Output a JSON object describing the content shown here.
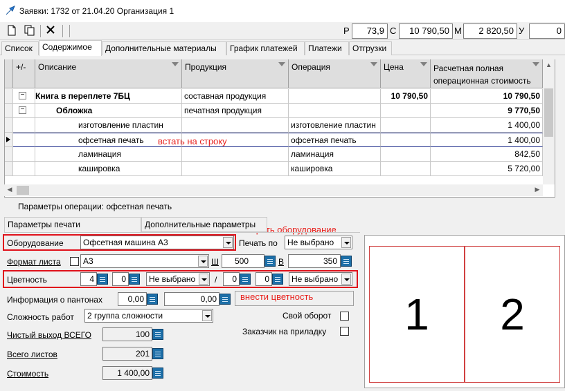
{
  "window": {
    "title": "Заявки: 1732 от 21.04.20  Организация 1"
  },
  "toolbar": {
    "icons": [
      "new-doc-icon",
      "copy-icon",
      "delete-icon"
    ],
    "summary": [
      {
        "label": "Р",
        "value": "73,9"
      },
      {
        "label": "С",
        "value": "10 790,50"
      },
      {
        "label": "М",
        "value": "2 820,50"
      },
      {
        "label": "У",
        "value": "0"
      }
    ]
  },
  "tabs": [
    "Список",
    "Содержимое",
    "Дополнительные материалы",
    "График платежей",
    "Платежи",
    "Отгрузки"
  ],
  "grid": {
    "headers": [
      "+/-",
      "Описание",
      "Продукция",
      "Операция",
      "Цена",
      "Расчетная полная операционная стоимость"
    ],
    "rows": [
      {
        "toggle": "−",
        "desc": "Книга в переплете 7БЦ",
        "product": "составная продукция",
        "operation": "",
        "price": "10 790,50",
        "cost": "10 790,50",
        "bold": true
      },
      {
        "toggle": "−",
        "desc": "Обложка",
        "product": "печатная продукция",
        "operation": "",
        "price": "",
        "cost": "9 770,50",
        "bold": true
      },
      {
        "toggle": "",
        "desc": "изготовление пластин",
        "product": "",
        "operation": "изготовление пластин",
        "price": "",
        "cost": "1 400,00"
      },
      {
        "toggle": "",
        "desc": "офсетная печать",
        "product": "",
        "operation": "офсетная печать",
        "price": "",
        "cost": "1 400,00",
        "current": true
      },
      {
        "toggle": "",
        "desc": "ламинация",
        "product": "",
        "operation": "ламинация",
        "price": "",
        "cost": "842,50"
      },
      {
        "toggle": "",
        "desc": "кашировка",
        "product": "",
        "operation": "кашировка",
        "price": "",
        "cost": "5 720,00"
      }
    ]
  },
  "annotations": {
    "select_row": "встать на строку",
    "select_equipment": "выбрать оборудование",
    "enter_color": "внести цветность"
  },
  "params": {
    "title": "Параметры операции: офсетная печать",
    "subtabs": [
      "Параметры печати",
      "Дополнительные параметры"
    ],
    "equipment_label": "Оборудование",
    "equipment_value": "Офсетная машина А3",
    "print_on_label": "Печать по",
    "print_on_value": "Не выбрано",
    "format_label": "Формат листа",
    "format_value": "А3",
    "width_label": "Ш",
    "width_value": "500",
    "height_label": "В",
    "height_value": "350",
    "color_label": "Цветность",
    "color_front_1": "4",
    "color_front_2": "0",
    "color_front_select": "Не выбрано",
    "color_slash": "/",
    "color_back_1": "0",
    "color_back_2": "0",
    "color_back_select": "Не выбрано",
    "pantone_label": "Информация о пантонах",
    "pantone_1": "0,00",
    "pantone_2": "0,00",
    "complexity_label": "Сложность работ",
    "complexity_value": "2 группа сложности",
    "own_turnover_label": "Свой оборот",
    "customer_label": "Заказчик на приладку",
    "net_output_label": "Чистый выход ВСЕГО",
    "net_output_value": "100",
    "sheets_label": "Всего листов",
    "sheets_value": "201",
    "cost_label": "Стоимость",
    "cost_value": "1 400,00"
  },
  "preview": {
    "pages": [
      "1",
      "2"
    ]
  }
}
